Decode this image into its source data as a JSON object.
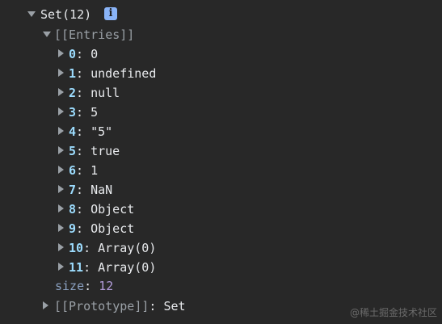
{
  "root": {
    "label": "Set(12)",
    "info_icon": "i"
  },
  "entries_group": {
    "label": "[[Entries]]",
    "items": [
      {
        "index": "0",
        "value": "0"
      },
      {
        "index": "1",
        "value": "undefined"
      },
      {
        "index": "2",
        "value": "null"
      },
      {
        "index": "3",
        "value": "5"
      },
      {
        "index": "4",
        "value": "\"5\""
      },
      {
        "index": "5",
        "value": "true"
      },
      {
        "index": "6",
        "value": "1"
      },
      {
        "index": "7",
        "value": "NaN"
      },
      {
        "index": "8",
        "value": "Object"
      },
      {
        "index": "9",
        "value": "Object"
      },
      {
        "index": "10",
        "value": "Array(0)"
      },
      {
        "index": "11",
        "value": "Array(0)"
      }
    ]
  },
  "size": {
    "key": "size",
    "value": "12"
  },
  "prototype": {
    "key": "[[Prototype]]",
    "value": "Set"
  },
  "watermark": "@稀土掘金技术社区",
  "colors": {
    "background": "#282828",
    "key": "#9cdcfe",
    "size_value": "#b39ddb",
    "info_badge": "#8ab4f8"
  }
}
